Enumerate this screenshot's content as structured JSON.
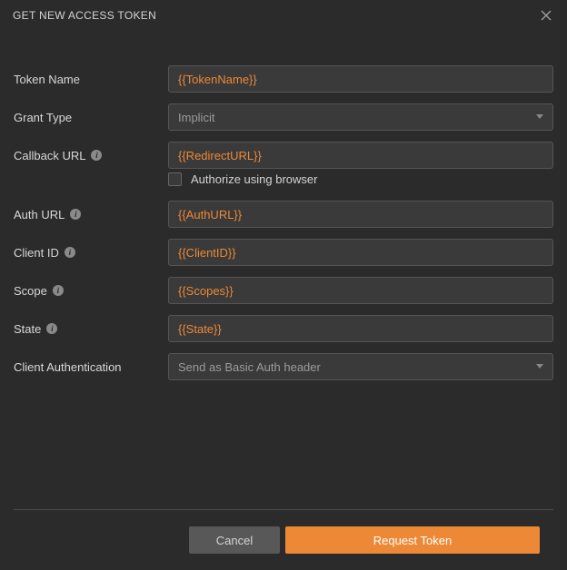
{
  "header": {
    "title": "GET NEW ACCESS TOKEN"
  },
  "labels": {
    "tokenName": "Token Name",
    "grantType": "Grant Type",
    "callbackURL": "Callback URL",
    "authorizeBrowser": "Authorize using browser",
    "authURL": "Auth URL",
    "clientID": "Client ID",
    "scope": "Scope",
    "state": "State",
    "clientAuth": "Client Authentication"
  },
  "values": {
    "tokenName": "{{TokenName}}",
    "grantType": "Implicit",
    "callbackURL": "{{RedirectURL}}",
    "authURL": "{{AuthURL}}",
    "clientID": "{{ClientID}}",
    "scope": "{{Scopes}}",
    "state": "{{State}}",
    "clientAuth": "Send as Basic Auth header"
  },
  "buttons": {
    "cancel": "Cancel",
    "request": "Request Token"
  }
}
